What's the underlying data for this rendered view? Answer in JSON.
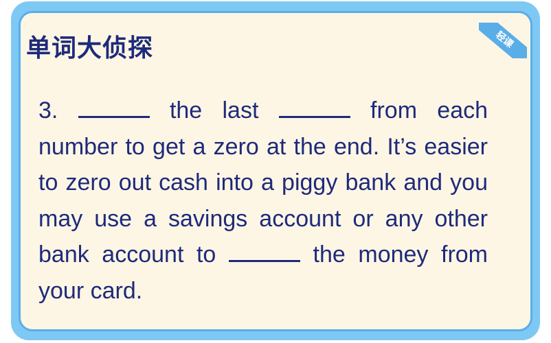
{
  "card": {
    "title": "单词大侦探",
    "corner_tag": "轻课",
    "question_number": "3.",
    "passage": [
      "the last",
      "from each number to get a zero at the end. It’s easier to zero out cash into a piggy bank and you may use a savings account or any other bank account to",
      "the money from your card."
    ]
  },
  "colors": {
    "frame": "#7ec8f4",
    "card_border": "#5aaee8",
    "card_background": "#fdf6e5",
    "text": "#1e2a7a"
  }
}
